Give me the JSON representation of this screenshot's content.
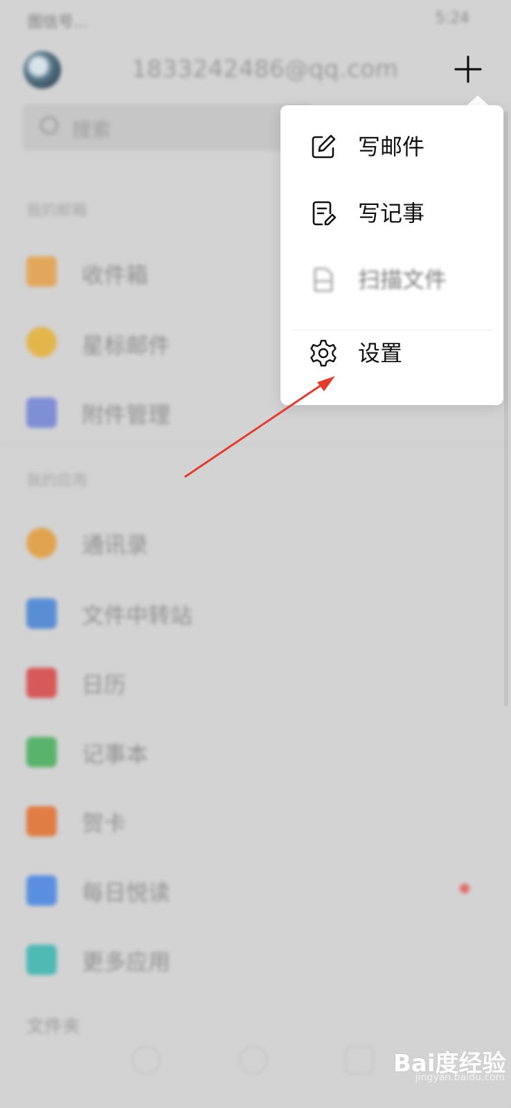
{
  "status_bar": {
    "left": "图信号…",
    "right": "5:24"
  },
  "header": {
    "account": "1833242486@qq.com",
    "search_placeholder": "搜索"
  },
  "sections": [
    {
      "title": "我的邮箱",
      "items": [
        {
          "label": "收件箱",
          "color": "#e3a75c"
        },
        {
          "label": "星标邮件",
          "color": "#e2b64b"
        },
        {
          "label": "附件管理",
          "color": "#7f8fd6"
        }
      ]
    },
    {
      "title": "我的应用",
      "items": [
        {
          "label": "通讯录",
          "color": "#e0a44f"
        },
        {
          "label": "文件中转站",
          "color": "#5a8ed4"
        },
        {
          "label": "日历",
          "color": "#d65a5a"
        },
        {
          "label": "记事本",
          "color": "#5ab36b"
        },
        {
          "label": "贺卡",
          "color": "#e07d45"
        },
        {
          "label": "每日悦读",
          "color": "#5a8fe0"
        },
        {
          "label": "更多应用",
          "color": "#4fb9b4"
        }
      ]
    },
    {
      "title": "文件夹",
      "items": []
    }
  ],
  "popup_menu": {
    "items": [
      {
        "label": "写邮件",
        "icon": "compose-icon"
      },
      {
        "label": "写记事",
        "icon": "note-icon"
      },
      {
        "label": "扫描文件",
        "icon": "scan-doc-icon"
      },
      {
        "label": "设置",
        "icon": "gear-icon"
      }
    ]
  },
  "colors": {
    "arrow": "#e53b2c",
    "popup_bg": "#ffffff",
    "backdrop": "#d3d3d3"
  },
  "watermark": {
    "text": "Bai度经验",
    "sub": "jingyan.baidu.com"
  }
}
